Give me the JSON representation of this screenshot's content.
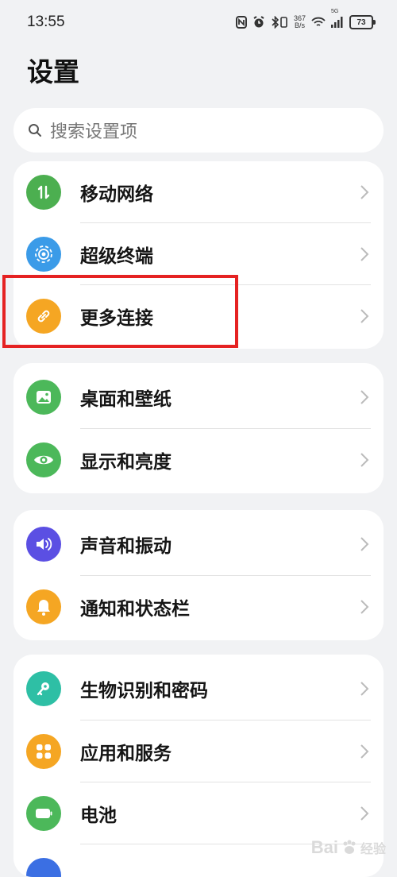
{
  "status_bar": {
    "time": "13:55",
    "network_speed_value": "367",
    "network_speed_unit": "B/s",
    "network_type": "5G",
    "battery_level": "73"
  },
  "page": {
    "title": "设置"
  },
  "search": {
    "placeholder": "搜索设置项"
  },
  "groups": [
    {
      "items": [
        {
          "label": "移动网络",
          "icon": "mobile-network-icon",
          "color": "#4caf50"
        },
        {
          "label": "超级终端",
          "icon": "super-device-icon",
          "color": "#3b9be8"
        },
        {
          "label": "更多连接",
          "icon": "link-icon",
          "color": "#f5a623"
        }
      ]
    },
    {
      "items": [
        {
          "label": "桌面和壁纸",
          "icon": "wallpaper-icon",
          "color": "#4cb85a"
        },
        {
          "label": "显示和亮度",
          "icon": "eye-icon",
          "color": "#4cb85a"
        }
      ]
    },
    {
      "items": [
        {
          "label": "声音和振动",
          "icon": "speaker-icon",
          "color": "#5b4fe3"
        },
        {
          "label": "通知和状态栏",
          "icon": "bell-icon",
          "color": "#f5a623"
        }
      ]
    },
    {
      "items": [
        {
          "label": "生物识别和密码",
          "icon": "key-icon",
          "color": "#2ebfa5"
        },
        {
          "label": "应用和服务",
          "icon": "apps-grid-icon",
          "color": "#f5a623"
        },
        {
          "label": "电池",
          "icon": "battery-icon",
          "color": "#4cb85a"
        }
      ]
    }
  ],
  "highlight_color": "#e52222",
  "watermark": {
    "text": "Bai",
    "sub": "经验"
  }
}
